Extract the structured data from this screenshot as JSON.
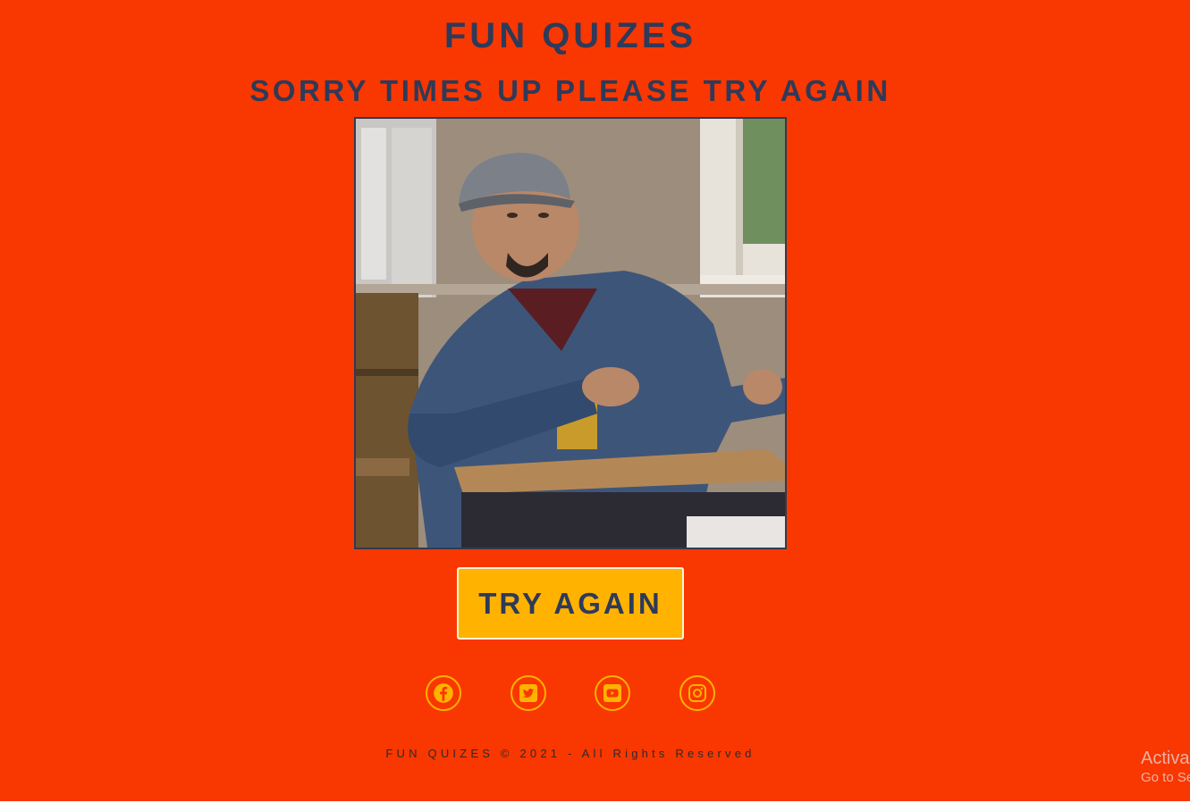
{
  "header": {
    "title": "FUN QUIZES",
    "message": "SORRY TIMES UP PLEASE TRY AGAIN"
  },
  "media": {
    "alt": "Man at a school desk making a disappointed gesture"
  },
  "actions": {
    "try_again_label": "TRY AGAIN"
  },
  "social": [
    {
      "icon": "facebook-icon"
    },
    {
      "icon": "twitter-icon"
    },
    {
      "icon": "youtube-icon"
    },
    {
      "icon": "instagram-icon"
    }
  ],
  "footer": {
    "copyright": "FUN QUIZES © 2021 - All Rights Reserved"
  },
  "os_watermark": {
    "line1": "Activa",
    "line2": "Go to Se"
  },
  "colors": {
    "background": "#f93700",
    "heading": "#2e3a59",
    "accent": "#ffb300"
  }
}
